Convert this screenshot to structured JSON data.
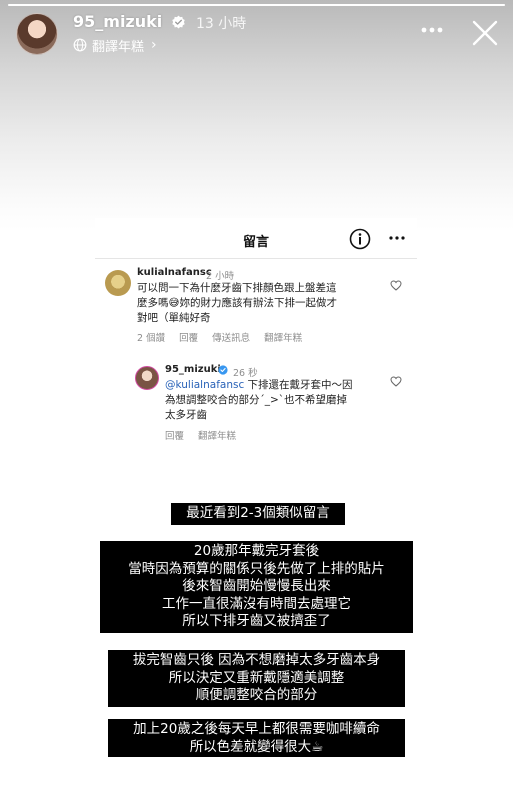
{
  "story": {
    "progress": 1.0,
    "username": "95_mizuki",
    "time_ago": "13 小時",
    "translate_label": "翻譯年糕",
    "translate_chevron": "›"
  },
  "screenshot": {
    "title": "留言",
    "comment": {
      "user": "kulialnafansc",
      "time": "2 小時",
      "text_lines": [
        "可以問一下為什麼牙齒下排顏色跟上盤差這",
        "麼多嗎😅妳的財力應該有辦法下排一起做才",
        "對吧（單純好奇"
      ],
      "actions": [
        "2 個讚",
        "回覆",
        "傳送訊息",
        "翻譯年糕"
      ]
    },
    "reply": {
      "user": "95_mizuki",
      "time": "26 秒",
      "mention": "@kulialnafansc",
      "text_first": " 下排還在戴牙套中～因",
      "text_lines": [
        "為想調整咬合的部分´_>`也不希望磨掉",
        "太多牙齒"
      ],
      "actions": [
        "回覆",
        "翻譯年糕"
      ]
    }
  },
  "captions": [
    {
      "lines": [
        "最近看到2-3個類似留言"
      ]
    },
    {
      "lines": [
        "20歲那年戴完牙套後",
        "當時因為預算的關係只後先做了上排的貼片",
        "後來智齒開始慢慢長出來",
        "工作一直很滿沒有時間去處理它",
        "所以下排牙齒又被擠歪了"
      ]
    },
    {
      "lines": [
        "拔完智齒只後 因為不想磨掉太多牙齒本身",
        "所以決定又重新戴隱適美調整",
        "順便調整咬合的部分"
      ]
    },
    {
      "lines": [
        "加上20歲之後每天早上都很需要咖啡續命",
        "所以色差就變得很大☕"
      ]
    }
  ],
  "colors": {
    "verified": "#3897f0",
    "mention": "#2a63b8",
    "caption_bg": "#000000"
  },
  "icons": {
    "verified": "verified-badge-icon",
    "globe": "globe-icon",
    "more": "more-icon",
    "close": "close-icon",
    "info": "info-icon",
    "heart": "heart-icon"
  }
}
